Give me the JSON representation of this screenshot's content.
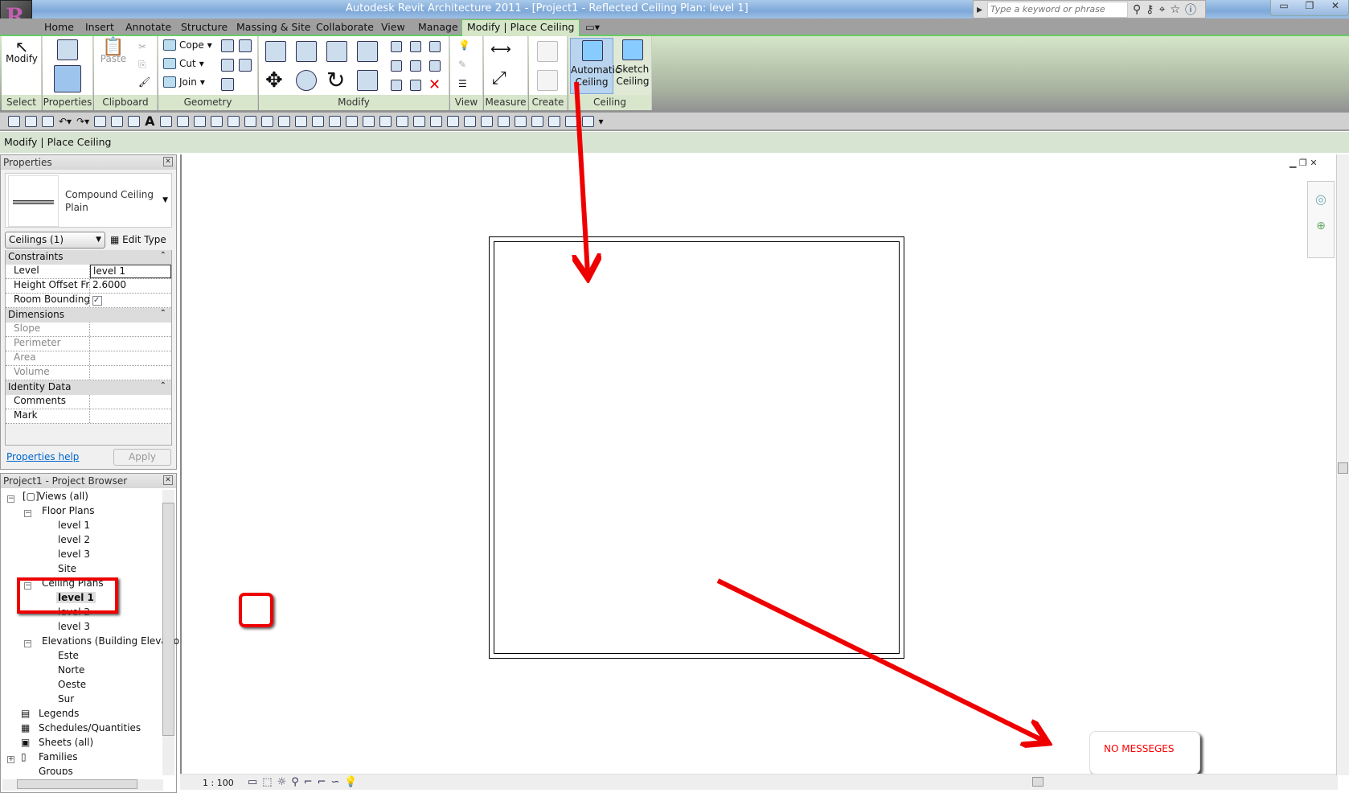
{
  "title": "Autodesk Revit Architecture 2011 - [Project1 - Reflected Ceiling Plan: level 1]",
  "search_placeholder": "Type a keyword or phrase",
  "tabs": [
    "Home",
    "Insert",
    "Annotate",
    "Structure",
    "Massing & Site",
    "Collaborate",
    "View",
    "Manage",
    "Modify | Place Ceiling"
  ],
  "ribbon": {
    "panels": [
      "Select",
      "Properties",
      "Clipboard",
      "Geometry",
      "Modify",
      "View",
      "Measure",
      "Create",
      "Ceiling"
    ],
    "modify": "Modify",
    "paste": "Paste",
    "cope": "Cope",
    "cut": "Cut",
    "join": "Join",
    "automatic_ceiling": [
      "Automatic",
      "Ceiling"
    ],
    "sketch_ceiling": [
      "Sketch",
      "Ceiling"
    ]
  },
  "options_bar": "Modify | Place Ceiling",
  "properties": {
    "title": "Properties",
    "type_name": [
      "Compound Ceiling",
      "Plain"
    ],
    "filter": "Ceilings (1)",
    "edit_type": "Edit Type",
    "groups": [
      {
        "name": "Constraints",
        "rows": [
          {
            "k": "Level",
            "v": "level 1"
          },
          {
            "k": "Height Offset Fr...",
            "v": "2.6000"
          },
          {
            "k": "Room Bounding",
            "v": "checked"
          }
        ]
      },
      {
        "name": "Dimensions",
        "rows": [
          {
            "k": "Slope",
            "v": ""
          },
          {
            "k": "Perimeter",
            "v": ""
          },
          {
            "k": "Area",
            "v": ""
          },
          {
            "k": "Volume",
            "v": ""
          }
        ]
      },
      {
        "name": "Identity Data",
        "rows": [
          {
            "k": "Comments",
            "v": ""
          },
          {
            "k": "Mark",
            "v": ""
          }
        ]
      }
    ],
    "help": "Properties help",
    "apply": "Apply"
  },
  "browser": {
    "title": "Project1 - Project Browser",
    "views_all": "Views (all)",
    "floor_plans": "Floor Plans",
    "floor_items": [
      "level 1",
      "level 2",
      "level 3",
      "Site"
    ],
    "ceiling_plans": "Ceiling Plans",
    "ceiling_items": [
      "level 1",
      "level 2",
      "level 3"
    ],
    "elevations": "Elevations (Building Elevatio",
    "elevation_items": [
      "Este",
      "Norte",
      "Oeste",
      "Sur"
    ],
    "others": [
      "Legends",
      "Schedules/Quantities",
      "Sheets (all)",
      "Families",
      "Groups"
    ]
  },
  "view_scale": "1 : 100",
  "message": "NO MESSEGES",
  "annotation_color": "#ee0000"
}
